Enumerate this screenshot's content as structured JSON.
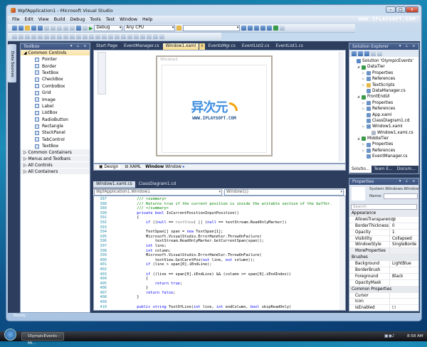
{
  "window": {
    "title": "WpfApplication1 - Microsoft Visual Studio",
    "watermark": "WWW.IPLAYSOFT.COM",
    "controls": [
      "–",
      "□",
      "x"
    ]
  },
  "menu": [
    "File",
    "Edit",
    "View",
    "Build",
    "Debug",
    "Tools",
    "Test",
    "Window",
    "Help"
  ],
  "toolbar": {
    "config": "Debug",
    "platform": "Any CPU",
    "find": ""
  },
  "data_sources_tab": "Data Sources",
  "toolbox": {
    "title": "Toolbox",
    "open_category": "Common Controls",
    "items": [
      "Pointer",
      "Border",
      "TextBox",
      "CheckBox",
      "ComboBox",
      "Grid",
      "Image",
      "Label",
      "ListBox",
      "RadioButton",
      "Rectangle",
      "StackPanel",
      "TabControl",
      "TextBox"
    ],
    "categories": [
      "Common Containers",
      "Menus and Toolbars",
      "All Controls",
      "All Containers"
    ]
  },
  "designer": {
    "tabs": [
      "Start Page",
      "EventManager.cs",
      "Window1.xaml",
      "EventsMgr.cs",
      "EventList2.cs",
      "EventList1.cs"
    ],
    "active_tab": "Window1.xaml",
    "window_caption": "Window1",
    "logo_text": "异次元",
    "logo_url": "WWW.IPLAYSOFT.COM",
    "design_tab": "Design",
    "xaml_tab": "XAML",
    "breadcrumb_bold": "Window",
    "breadcrumb": "Window"
  },
  "editor": {
    "tabs": [
      "Window1.xaml.cs",
      "ClassDiagram1.cd"
    ],
    "active_tab": "Window1.xaml.cs",
    "type_dropdown": "WpfApplication1.Window1",
    "member_dropdown": "Window1()",
    "lines": [
      {
        "n": "387",
        "s": [
          [
            "g",
            "            /// <summary>"
          ]
        ]
      },
      {
        "n": "388",
        "s": [
          [
            "g",
            "            /// Returns true if the current position is inside the writable section of the buffer."
          ]
        ]
      },
      {
        "n": "389",
        "s": [
          [
            "g",
            "            /// </summary>"
          ]
        ]
      },
      {
        "n": "390",
        "s": [
          [
            "k",
            "            private bool "
          ],
          [
            "",
            "IsCurrentPositionInputPosition()"
          ]
        ]
      },
      {
        "n": "391",
        "s": [
          [
            "",
            "            {"
          ]
        ]
      },
      {
        "n": "392",
        "s": [
          [
            "k",
            "                if "
          ],
          [
            "",
            "(("
          ],
          [
            "k",
            "null"
          ],
          [
            "",
            " == "
          ],
          [
            "gr",
            "textView"
          ],
          [
            "",
            ") || ("
          ],
          [
            "k",
            "null"
          ],
          [
            "",
            " == textStream.ReadOnlyMarker))"
          ]
        ]
      },
      {
        "n": "393",
        "s": [
          [
            "",
            ""
          ]
        ]
      },
      {
        "n": "394",
        "s": [
          [
            "",
            "                TextSpan[] span = "
          ],
          [
            "k",
            "new "
          ],
          [
            "",
            "TextSpan[1];"
          ]
        ]
      },
      {
        "n": "395",
        "s": [
          [
            "",
            "                Microsoft.VisualStudio.ErrorHandler.ThrowOnFailure("
          ]
        ]
      },
      {
        "n": "396",
        "s": [
          [
            "",
            "                    textStream.ReadOnlyMarker.GetCurrentSpan(span));"
          ]
        ]
      },
      {
        "n": "397",
        "s": [
          [
            "k",
            "                int "
          ],
          [
            "",
            "line;"
          ]
        ]
      },
      {
        "n": "398",
        "s": [
          [
            "k",
            "                int "
          ],
          [
            "",
            "column;"
          ]
        ]
      },
      {
        "n": "399",
        "s": [
          [
            "",
            "                Microsoft.VisualStudio.ErrorHandler.ThrowOnFailure("
          ]
        ]
      },
      {
        "n": "400",
        "s": [
          [
            "",
            "                    textView.GetCaretPos("
          ],
          [
            "k",
            "out "
          ],
          [
            "",
            "line, "
          ],
          [
            "k",
            "out "
          ],
          [
            "",
            "column));"
          ]
        ]
      },
      {
        "n": "401",
        "s": [
          [
            "k",
            "                if "
          ],
          [
            "",
            "(line > span[0].iEndLine);"
          ]
        ]
      },
      {
        "n": "402",
        "s": [
          [
            "",
            ""
          ]
        ]
      },
      {
        "n": "403",
        "s": [
          [
            "k",
            "                if "
          ],
          [
            "",
            "((line == span[0].iEndLine) && (column >= span[0].iEndIndex))"
          ]
        ]
      },
      {
        "n": "404",
        "s": [
          [
            "",
            "                {"
          ]
        ]
      },
      {
        "n": "405",
        "s": [
          [
            "k",
            "                    return true"
          ],
          [
            "",
            ";"
          ]
        ]
      },
      {
        "n": "406",
        "s": [
          [
            "",
            "                }"
          ]
        ]
      },
      {
        "n": "407",
        "s": [
          [
            "k",
            "                return false"
          ],
          [
            "",
            ";"
          ]
        ]
      },
      {
        "n": "408",
        "s": [
          [
            "",
            "            }"
          ]
        ]
      },
      {
        "n": "409",
        "s": [
          [
            "",
            ""
          ]
        ]
      },
      {
        "n": "410",
        "s": [
          [
            "k",
            "            public string "
          ],
          [
            "",
            "TextOfLine("
          ],
          [
            "k",
            "int "
          ],
          [
            "",
            "line, "
          ],
          [
            "k",
            "int "
          ],
          [
            "",
            "endColumn, "
          ],
          [
            "k",
            "bool "
          ],
          [
            "",
            "skipReadOnly)"
          ]
        ]
      }
    ]
  },
  "solution_explorer": {
    "title": "Solution Explorer",
    "tree": [
      {
        "d": 0,
        "t": "Solution 'OlympicEvents'"
      },
      {
        "d": 1,
        "t": "DataTier"
      },
      {
        "d": 2,
        "t": "Properties"
      },
      {
        "d": 2,
        "t": "References"
      },
      {
        "d": 2,
        "t": "TextScripts"
      },
      {
        "d": 2,
        "t": "DataManager.cs"
      },
      {
        "d": 1,
        "t": "FrontEndUI"
      },
      {
        "d": 2,
        "t": "Properties"
      },
      {
        "d": 2,
        "t": "References"
      },
      {
        "d": 2,
        "t": "App.xaml"
      },
      {
        "d": 2,
        "t": "ClassDiagram1.cd"
      },
      {
        "d": 2,
        "t": "Window1.xaml"
      },
      {
        "d": 3,
        "t": "Window1.xaml.cs"
      },
      {
        "d": 1,
        "t": "MiddleTier"
      },
      {
        "d": 2,
        "t": "Properties"
      },
      {
        "d": 2,
        "t": "References"
      },
      {
        "d": 2,
        "t": "EventManager.cs"
      }
    ],
    "bottom_tabs": [
      "Solutio...",
      "Team E...",
      "Docum..."
    ]
  },
  "properties": {
    "title": "Properties",
    "type": "System.Windows.Window",
    "name_label": "Name:",
    "name_value": "",
    "search_placeholder": "Search",
    "rows": [
      {
        "cat": "Appearance"
      },
      {
        "n": "AllowsTransparency",
        "v": "☐"
      },
      {
        "n": "BorderThickness",
        "v": "0"
      },
      {
        "n": "Opacity",
        "v": "1"
      },
      {
        "n": "Visibility",
        "v": "Collapsed"
      },
      {
        "n": "WindowStyle",
        "v": "SingleBorde"
      },
      {
        "n": "MoreProperties",
        "v": "",
        "shade": true
      },
      {
        "cat": "Brushes"
      },
      {
        "n": "Background",
        "v": "LightBlue"
      },
      {
        "n": "BorderBrush",
        "v": ""
      },
      {
        "n": "Foreground",
        "v": "Black"
      },
      {
        "n": "OpacityMask",
        "v": ""
      },
      {
        "cat": "Common Properties"
      },
      {
        "n": "Cursor",
        "v": ""
      },
      {
        "n": "Icon",
        "v": ""
      },
      {
        "n": "IsEnabled",
        "v": "☐"
      }
    ]
  },
  "status": "Ready",
  "taskbar": {
    "item": "OlympicEvents - Mi...",
    "time": "8:58 AM"
  }
}
